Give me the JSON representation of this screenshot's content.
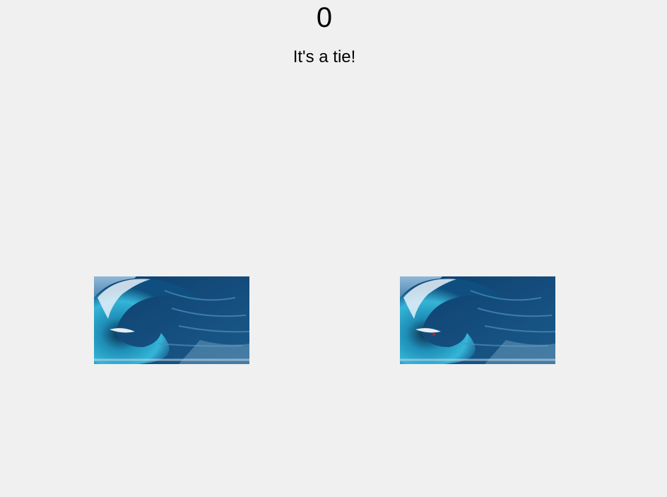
{
  "score": "0",
  "result_message": "It's a tie!",
  "choices": [
    {
      "icon": "wave-icon"
    },
    {
      "icon": "wave-icon"
    }
  ]
}
